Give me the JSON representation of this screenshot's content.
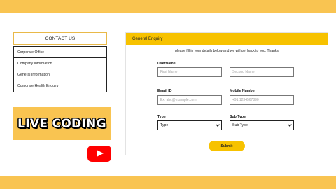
{
  "colors": {
    "accent": "#f9c451",
    "header": "#f7c200",
    "youtube": "#ff0000"
  },
  "menu": {
    "title": "CONTACT US",
    "items": [
      {
        "label": "Corporate Office"
      },
      {
        "label": "Company Information"
      },
      {
        "label": "General Information"
      },
      {
        "label": "Corporate Health Enquiry"
      }
    ]
  },
  "badge": {
    "text": "LIVE CODING",
    "icon": "youtube-play-icon"
  },
  "form": {
    "header": "General Enquiry",
    "intro": "please fill in your details below and we will get back to you. Thanks",
    "username_label": "UserName",
    "first_name_placeholder": "First Name",
    "second_name_placeholder": "Second Name",
    "email_label": "Email ID",
    "email_placeholder": "Ex: abc@example.com",
    "mobile_label": "Mobile Number",
    "mobile_placeholder": "+91 1234567890",
    "type_label": "Type",
    "type_value": "Type",
    "subtype_label": "Sub Type",
    "subtype_value": "Sub Type",
    "submit_label": "Submit"
  }
}
